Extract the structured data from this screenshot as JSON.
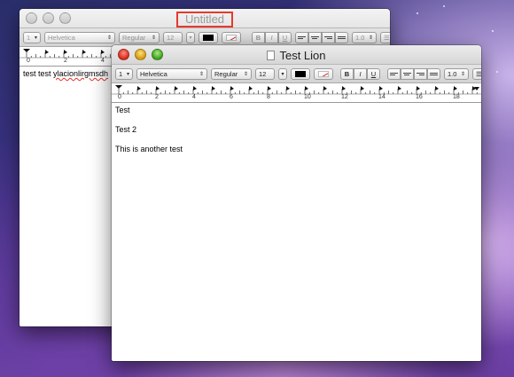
{
  "back_window": {
    "title": "Untitled",
    "toolbar": {
      "style_button": "1",
      "font_family": "Helvetica",
      "font_style": "Regular",
      "font_size": "12",
      "bold": "B",
      "italic": "I",
      "underline": "U",
      "line_spacing": "1.0"
    },
    "ruler_labels": [
      "0",
      "2",
      "4"
    ],
    "text_prefix": "test test ",
    "text_misspelled": "ylacionlirgmsdh"
  },
  "front_window": {
    "title": "Test Lion",
    "toolbar": {
      "style_button": "1",
      "font_family": "Helvetica",
      "font_style": "Regular",
      "font_size": "12",
      "bold": "B",
      "italic": "I",
      "underline": "U",
      "line_spacing": "1.0"
    },
    "ruler_labels": [
      "0",
      "2",
      "4",
      "6",
      "8",
      "10",
      "12",
      "14",
      "16",
      "18"
    ],
    "paragraphs": [
      "Test",
      "Test 2",
      "This is another test"
    ]
  },
  "colors": {
    "highlight_box": "#e53a2e",
    "close": "#d42b1e",
    "minimize": "#d49a10",
    "zoom": "#3d9f1f"
  }
}
